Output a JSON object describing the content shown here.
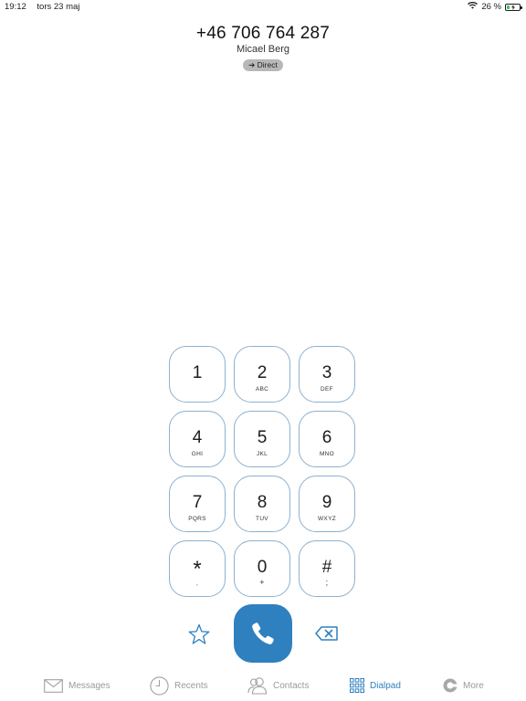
{
  "status_bar": {
    "time": "19:12",
    "date": "tors 23 maj",
    "battery_percent": "26 %",
    "battery_level": 0.26,
    "battery_color": "#34c759"
  },
  "call": {
    "number": "+46 706 764 287",
    "contact_name": "Micael Berg",
    "route_label": "➔ Direct"
  },
  "keypad": {
    "keys": [
      {
        "digit": "1",
        "letters": ""
      },
      {
        "digit": "2",
        "letters": "ABC"
      },
      {
        "digit": "3",
        "letters": "DEF"
      },
      {
        "digit": "4",
        "letters": "GHI"
      },
      {
        "digit": "5",
        "letters": "JKL"
      },
      {
        "digit": "6",
        "letters": "MNO"
      },
      {
        "digit": "7",
        "letters": "PQRS"
      },
      {
        "digit": "8",
        "letters": "TUV"
      },
      {
        "digit": "9",
        "letters": "WXYZ"
      },
      {
        "digit": "*",
        "letters": ","
      },
      {
        "digit": "0",
        "letters": "+"
      },
      {
        "digit": "#",
        "letters": ";"
      }
    ],
    "accent_color": "#2f80bf",
    "key_border_color": "#8db0cf"
  },
  "actions": {
    "favorite_icon": "star-icon",
    "call_icon": "phone-icon",
    "backspace_icon": "backspace-icon"
  },
  "tabs": [
    {
      "label": "Messages",
      "icon": "envelope-icon",
      "active": false
    },
    {
      "label": "Recents",
      "icon": "clock-icon",
      "active": false
    },
    {
      "label": "Contacts",
      "icon": "contacts-icon",
      "active": false
    },
    {
      "label": "Dialpad",
      "icon": "dialpad-icon",
      "active": true
    },
    {
      "label": "More",
      "icon": "more-icon",
      "active": false
    }
  ]
}
